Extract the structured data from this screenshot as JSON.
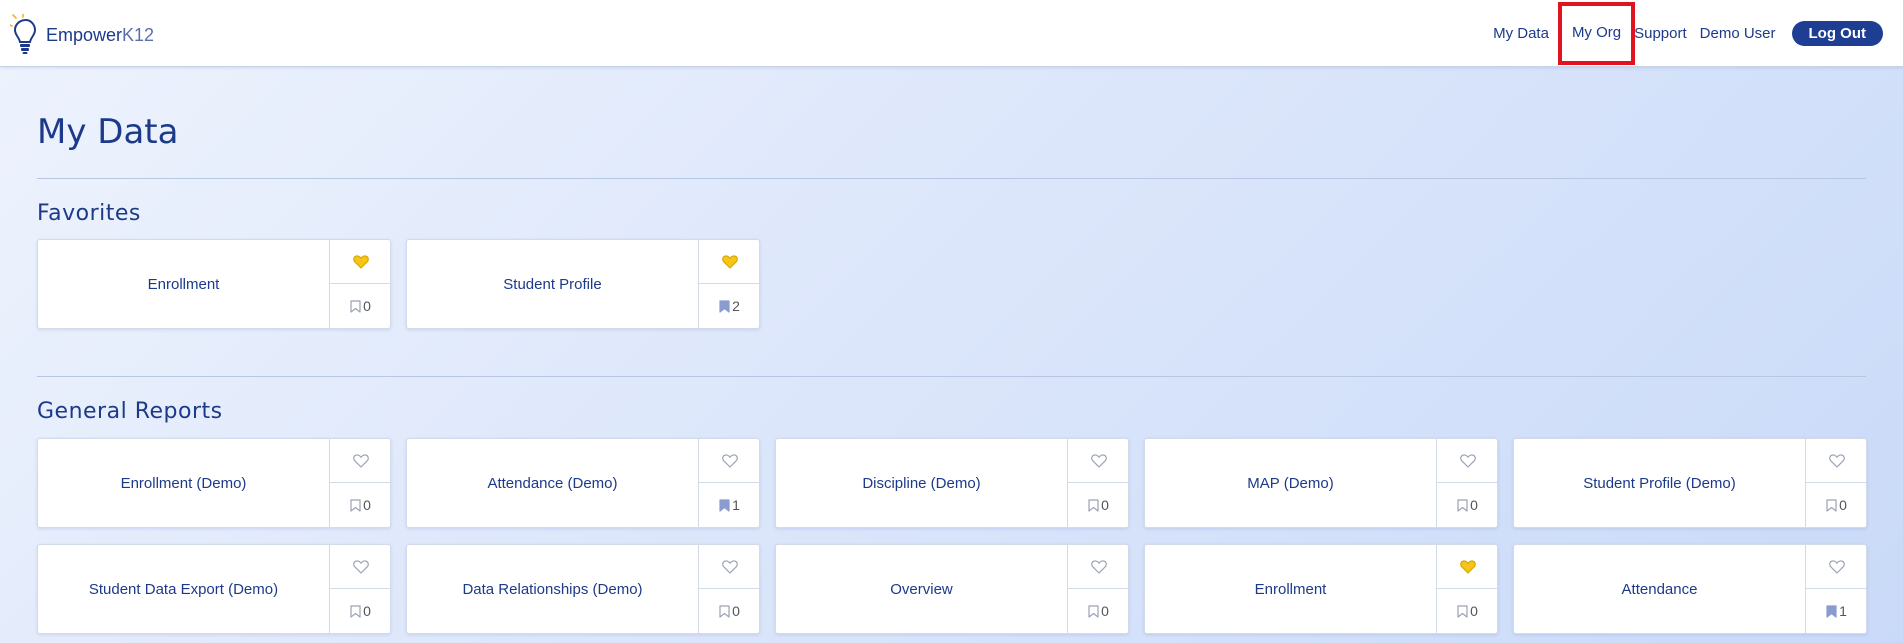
{
  "header": {
    "logo_text_main": "Empower",
    "logo_text_suffix": "K12",
    "nav": {
      "my_data": "My Data",
      "my_org": "My Org",
      "support": "Support",
      "user": "Demo User",
      "logout": "Log Out"
    }
  },
  "page": {
    "title": "My Data"
  },
  "favorites": {
    "title": "Favorites",
    "cards": [
      {
        "label": "Enrollment",
        "favorited": true,
        "bookmarks": "0",
        "bookmarked": false
      },
      {
        "label": "Student Profile",
        "favorited": true,
        "bookmarks": "2",
        "bookmarked": true
      }
    ]
  },
  "general_reports": {
    "title": "General Reports",
    "cards": [
      {
        "label": "Enrollment (Demo)",
        "favorited": false,
        "bookmarks": "0",
        "bookmarked": false
      },
      {
        "label": "Attendance (Demo)",
        "favorited": false,
        "bookmarks": "1",
        "bookmarked": true
      },
      {
        "label": "Discipline (Demo)",
        "favorited": false,
        "bookmarks": "0",
        "bookmarked": false
      },
      {
        "label": "MAP (Demo)",
        "favorited": false,
        "bookmarks": "0",
        "bookmarked": false
      },
      {
        "label": "Student Profile (Demo)",
        "favorited": false,
        "bookmarks": "0",
        "bookmarked": false
      },
      {
        "label": "Student Data Export (Demo)",
        "favorited": false,
        "bookmarks": "0",
        "bookmarked": false
      },
      {
        "label": "Data Relationships (Demo)",
        "favorited": false,
        "bookmarks": "0",
        "bookmarked": false
      },
      {
        "label": "Overview",
        "favorited": false,
        "bookmarks": "0",
        "bookmarked": false
      },
      {
        "label": "Enrollment",
        "favorited": true,
        "bookmarks": "0",
        "bookmarked": false
      },
      {
        "label": "Attendance",
        "favorited": false,
        "bookmarks": "1",
        "bookmarked": true
      }
    ]
  },
  "colors": {
    "brand": "#1d3a8a",
    "heart_active": "#f5c518",
    "highlight": "#e0141e"
  }
}
